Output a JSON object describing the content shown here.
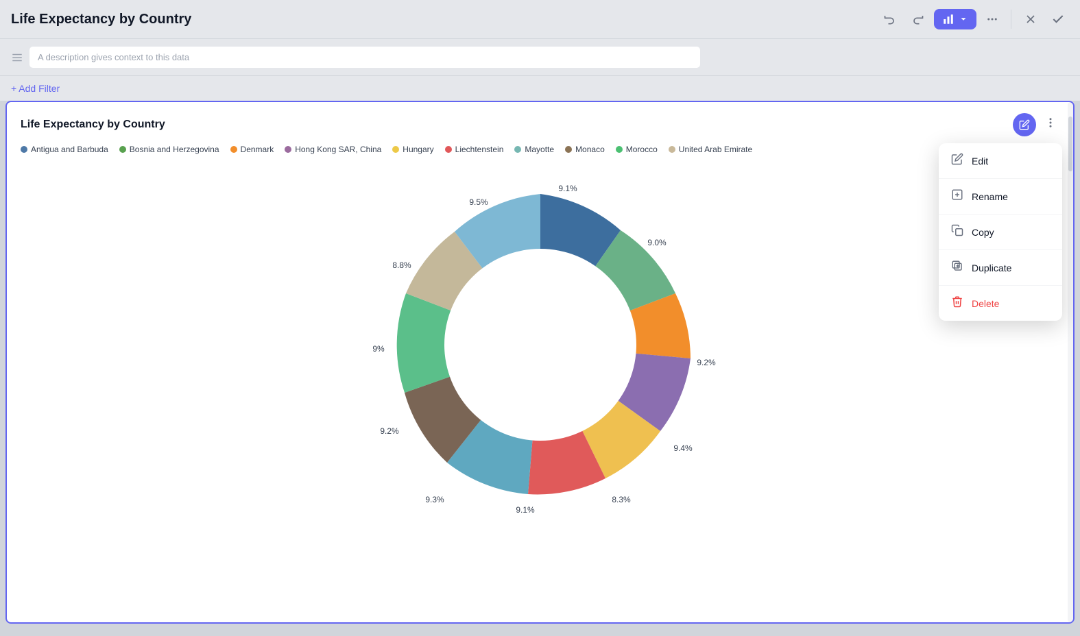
{
  "header": {
    "title": "Life Expectancy by Country",
    "description_placeholder": "A description gives context to this data",
    "add_filter_label": "+ Add Filter",
    "undo_label": "undo",
    "redo_label": "redo",
    "chart_type_label": "chart",
    "more_label": "more",
    "close_label": "close",
    "check_label": "check"
  },
  "chart": {
    "title": "Life Expectancy by Country",
    "legend": [
      {
        "label": "Antigua and Barbuda",
        "color": "#4e79a7"
      },
      {
        "label": "Bosnia and Herzegovina",
        "color": "#59a14f"
      },
      {
        "label": "Denmark",
        "color": "#f28e2b"
      },
      {
        "label": "Hong Kong SAR, China",
        "color": "#9b6b9e"
      },
      {
        "label": "Hungary",
        "color": "#edc948"
      },
      {
        "label": "Liechtenstein",
        "color": "#e15759"
      },
      {
        "label": "Mayotte",
        "color": "#76b7b2"
      },
      {
        "label": "Monaco",
        "color": "#8b7355"
      },
      {
        "label": "Morocco",
        "color": "#4bc072"
      },
      {
        "label": "United Arab Emirates",
        "color": "#c9b99a"
      }
    ],
    "segments": [
      {
        "label": "9.1%",
        "color": "#3d6e9e",
        "startAngle": -90,
        "endAngle": -57.4
      },
      {
        "label": "9.0%",
        "color": "#6ab187",
        "startAngle": -57.4,
        "endAngle": -24.4
      },
      {
        "label": "9.2%",
        "color": "#f28e2b",
        "startAngle": -24.4,
        "endAngle": 9.0
      },
      {
        "label": "9.4%",
        "color": "#8b6eb0",
        "startAngle": 9.0,
        "endAngle": 42.8
      },
      {
        "label": "8.3%",
        "color": "#efc050",
        "startAngle": 42.8,
        "endAngle": 72.7
      },
      {
        "label": "9.1%",
        "color": "#e05a5a",
        "startAngle": 72.7,
        "endAngle": 105.5
      },
      {
        "label": "9.3%",
        "color": "#5fa8c0",
        "startAngle": 105.5,
        "endAngle": 138.9
      },
      {
        "label": "9.2%",
        "color": "#7a6555",
        "startAngle": 138.9,
        "endAngle": 172.1
      },
      {
        "label": "9%",
        "color": "#5bbf8a",
        "startAngle": 172.1,
        "endAngle": 204.4
      },
      {
        "label": "8.8%",
        "color": "#c4b89a",
        "startAngle": 204.4,
        "endAngle": 236.2
      },
      {
        "label": "9.5%",
        "color": "#7eb8d4",
        "startAngle": 236.2,
        "endAngle": 270.6
      }
    ]
  },
  "context_menu": {
    "items": [
      {
        "label": "Edit",
        "icon": "✏️",
        "id": "edit"
      },
      {
        "label": "Rename",
        "icon": "⊞",
        "id": "rename"
      },
      {
        "label": "Copy",
        "icon": "⧉",
        "id": "copy"
      },
      {
        "label": "Duplicate",
        "icon": "⊕",
        "id": "duplicate"
      },
      {
        "label": "Delete",
        "icon": "🗑",
        "id": "delete"
      }
    ]
  }
}
